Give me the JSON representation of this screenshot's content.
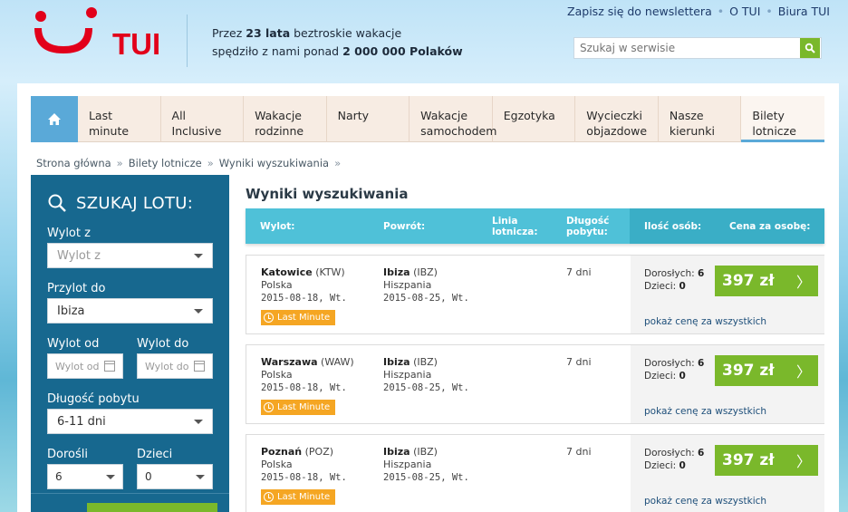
{
  "header": {
    "brand": "TUI",
    "tagline_line1_prefix": "Przez ",
    "tagline_years": "23 lata",
    "tagline_line1_suffix": " beztroskie wakacje",
    "tagline_line2_prefix": "spędziło z nami ponad ",
    "tagline_count": "2 000 000 Polaków",
    "links": [
      "Zapisz się do newslettera",
      "O TUI",
      "Biura TUI"
    ],
    "search_placeholder": "Szukaj w serwisie",
    "brand_color": "#e2001a"
  },
  "nav": {
    "items": [
      {
        "line1": "Last",
        "line2": "minute"
      },
      {
        "line1": "All",
        "line2": "Inclusive"
      },
      {
        "line1": "Wakacje",
        "line2": "rodzinne"
      },
      {
        "line1": "Narty",
        "line2": ""
      },
      {
        "line1": "Wakacje",
        "line2": "samochodem"
      },
      {
        "line1": "Egzotyka",
        "line2": ""
      },
      {
        "line1": "Wycieczki",
        "line2": "objazdowe"
      },
      {
        "line1": "Nasze",
        "line2": "kierunki"
      },
      {
        "line1": "Bilety",
        "line2": "lotnicze"
      }
    ],
    "active_index": 8
  },
  "breadcrumb": [
    "Strona główna",
    "Bilety lotnicze",
    "Wyniki wyszukiwania"
  ],
  "sidebar": {
    "title": "SZUKAJ LOTU:",
    "from_label": "Wylot z",
    "from_placeholder": "Wylot z",
    "to_label": "Przylot do",
    "to_value": "Ibiza",
    "date_from_label": "Wylot od",
    "date_from_placeholder": "Wylot od",
    "date_to_label": "Wylot do",
    "date_to_placeholder": "Wylot do",
    "duration_label": "Długość pobytu",
    "duration_value": "6-11 dni",
    "adults_label": "Dorośli",
    "adults_value": "6",
    "children_label": "Dzieci",
    "children_value": "0"
  },
  "results": {
    "title": "Wyniki wyszukiwania",
    "headers": {
      "departure": "Wylot:",
      "return": "Powrót:",
      "airline": [
        "Linia",
        "lotnicza:"
      ],
      "stay": [
        "Długość",
        "pobytu:"
      ],
      "persons": "Ilość osób:",
      "price": "Cena za osobę:"
    },
    "items": [
      {
        "from_city": "Katowice",
        "from_code": "(KTW)",
        "from_country": "Polska",
        "from_date": "2015-08-18, Wt.",
        "to_city": "Ibiza",
        "to_code": "(IBZ)",
        "to_country": "Hiszpania",
        "to_date": "2015-08-25, Wt.",
        "stay": "7 dni",
        "badge": "Last Minute",
        "adults_label": "Dorosłych:",
        "adults": "6",
        "children_label": "Dzieci:",
        "children": "0",
        "price": "397 zł",
        "all_price_link": "pokaż cenę za wszystkich"
      },
      {
        "from_city": "Warszawa",
        "from_code": "(WAW)",
        "from_country": "Polska",
        "from_date": "2015-08-18, Wt.",
        "to_city": "Ibiza",
        "to_code": "(IBZ)",
        "to_country": "Hiszpania",
        "to_date": "2015-08-25, Wt.",
        "stay": "7 dni",
        "badge": "Last Minute",
        "adults_label": "Dorosłych:",
        "adults": "6",
        "children_label": "Dzieci:",
        "children": "0",
        "price": "397 zł",
        "all_price_link": "pokaż cenę za wszystkich"
      },
      {
        "from_city": "Poznań",
        "from_code": "(POZ)",
        "from_country": "Polska",
        "from_date": "2015-08-18, Wt.",
        "to_city": "Ibiza",
        "to_code": "(IBZ)",
        "to_country": "Hiszpania",
        "to_date": "2015-08-25, Wt.",
        "stay": "7 dni",
        "badge": "Last Minute",
        "adults_label": "Dorosłych:",
        "adults": "6",
        "children_label": "Dzieci:",
        "children": "0",
        "price": "397 zł",
        "all_price_link": "pokaż cenę za wszystkich"
      }
    ]
  }
}
